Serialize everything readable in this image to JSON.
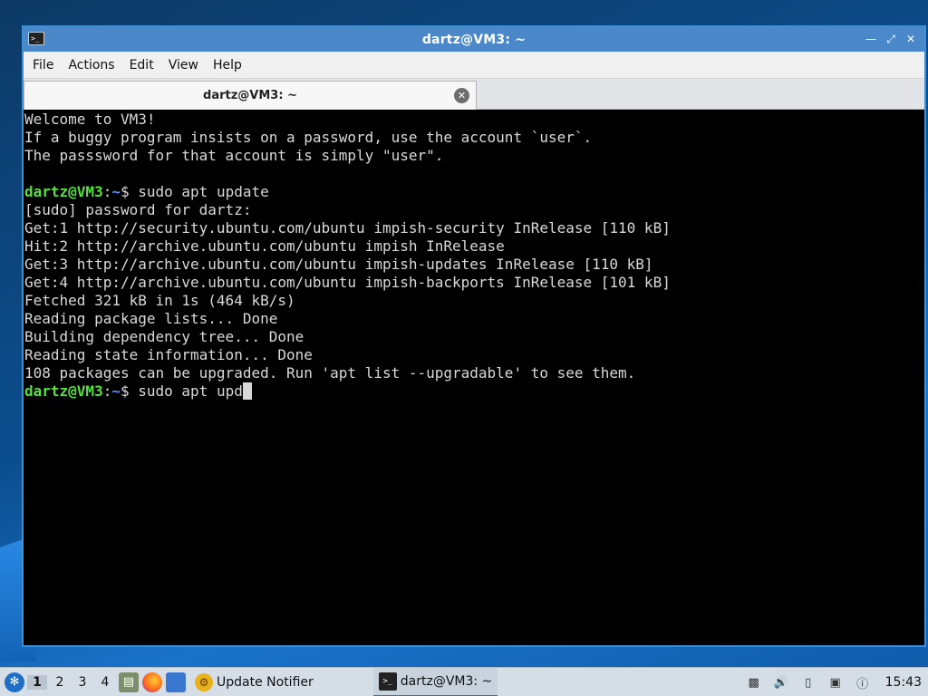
{
  "window": {
    "title": "dartz@VM3: ~",
    "icon": "terminal-icon",
    "controls": [
      "minimize",
      "maximize",
      "close"
    ]
  },
  "menubar": {
    "items": [
      "File",
      "Actions",
      "Edit",
      "View",
      "Help"
    ]
  },
  "tab": {
    "label": "dartz@VM3: ~",
    "close_icon": "close-icon"
  },
  "terminal": {
    "colors": {
      "background": "#000000",
      "text": "#d9d9d9",
      "user": "#54e33a",
      "path": "#5c8ff5"
    },
    "lines": [
      {
        "text": "Welcome to VM3!"
      },
      {
        "text": "If a buggy program insists on a password, use the account `user`."
      },
      {
        "text": "The passsword for that account is simply \"user\"."
      },
      {
        "text": ""
      },
      {
        "user": "dartz@VM3",
        "path": "~",
        "cmd": "$ sudo apt update"
      },
      {
        "text": "[sudo] password for dartz:"
      },
      {
        "text": "Get:1 http://security.ubuntu.com/ubuntu impish-security InRelease [110 kB]"
      },
      {
        "text": "Hit:2 http://archive.ubuntu.com/ubuntu impish InRelease"
      },
      {
        "text": "Get:3 http://archive.ubuntu.com/ubuntu impish-updates InRelease [110 kB]"
      },
      {
        "text": "Get:4 http://archive.ubuntu.com/ubuntu impish-backports InRelease [101 kB]"
      },
      {
        "text": "Fetched 321 kB in 1s (464 kB/s)"
      },
      {
        "text": "Reading package lists... Done"
      },
      {
        "text": "Building dependency tree... Done"
      },
      {
        "text": "Reading state information... Done"
      },
      {
        "text": "108 packages can be upgraded. Run 'apt list --upgradable' to see them."
      },
      {
        "user": "dartz@VM3",
        "path": "~",
        "cmd": "$ sudo apt upd",
        "cursor": true
      }
    ]
  },
  "taskbar": {
    "start_icon": "lubuntu-menu-icon",
    "desktops": [
      "1",
      "2",
      "3",
      "4"
    ],
    "active_desktop": "1",
    "launchers": [
      "file-manager-icon",
      "firefox-icon",
      "show-desktop-icon"
    ],
    "tasks": [
      {
        "label": "Update Notifier",
        "icon": "update-notifier-icon"
      },
      {
        "label": "dartz@VM3: ~",
        "icon": "terminal-icon",
        "active": true
      }
    ],
    "tray": [
      "clipboard-icon",
      "volume-icon",
      "notes-icon",
      "network-icon",
      "update-info-icon"
    ],
    "clock": "15:43"
  }
}
